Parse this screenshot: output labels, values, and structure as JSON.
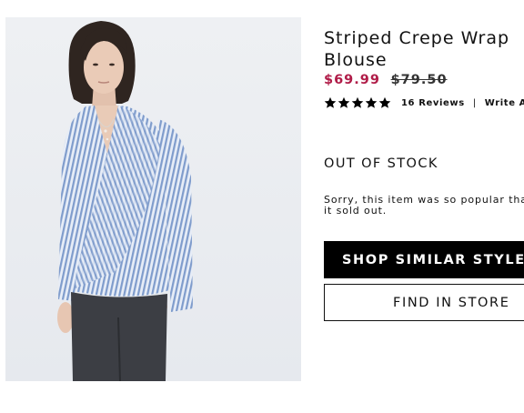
{
  "product": {
    "title": "Striped Crepe Wrap Blouse",
    "sale_price": "$69.99",
    "original_price": "$79.50",
    "rating_stars": 5,
    "reviews_label": "16 Reviews",
    "divider": "|",
    "write_review_label": "Write A Review",
    "stock_status": "OUT OF STOCK",
    "sorry_message": "Sorry, this item was so popular that it sold out."
  },
  "buttons": {
    "shop_similar": "SHOP SIMILAR STYLES",
    "find_in_store": "FIND IN STORE"
  },
  "colors": {
    "sale_price": "#b01c48",
    "primary_button": "#000000",
    "stripe_blue": "#7f9ccc"
  },
  "icons": {
    "star": "star-icon"
  }
}
